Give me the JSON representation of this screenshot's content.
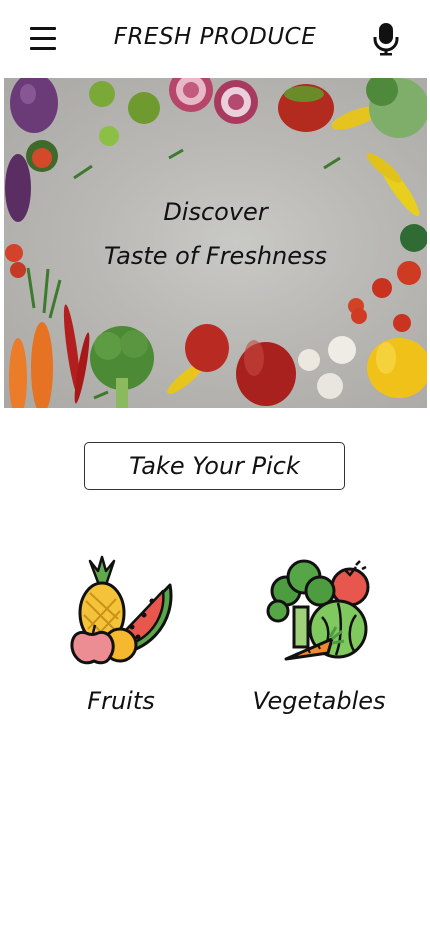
{
  "header": {
    "title": "FRESH PRODUCE",
    "menu_icon": "hamburger-menu-icon",
    "mic_icon": "microphone-icon"
  },
  "hero": {
    "line1": "Discover",
    "line2": "Taste of Freshness"
  },
  "pick_button": {
    "label": "Take Your Pick"
  },
  "categories": [
    {
      "label": "Fruits",
      "icon": "fruits-icon"
    },
    {
      "label": "Vegetables",
      "icon": "vegetables-icon"
    }
  ],
  "colors": {
    "background": "#ffffff",
    "text": "#111111",
    "hero_background": "#b9b8b5"
  }
}
